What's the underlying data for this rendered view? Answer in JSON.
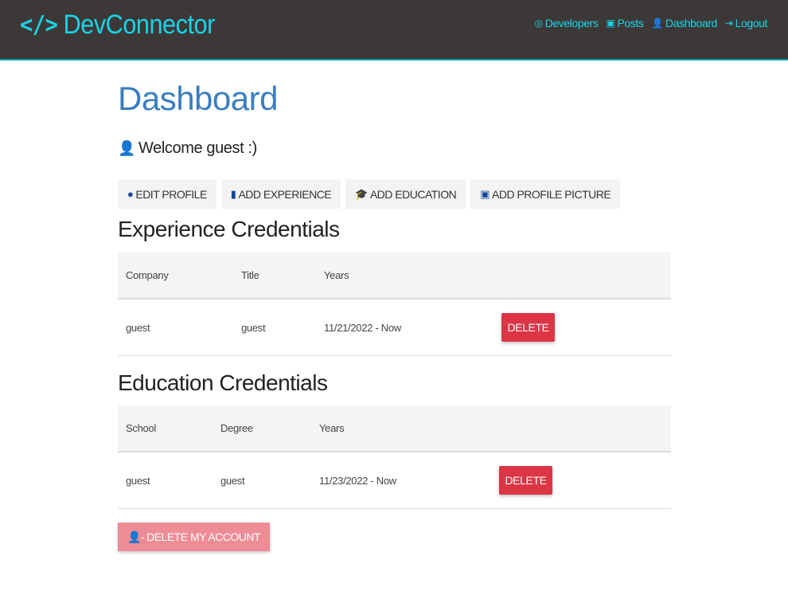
{
  "navbar": {
    "brand_icon": "</>",
    "brand": "DevConnector",
    "links": [
      {
        "label": "Developers",
        "icon": "◎"
      },
      {
        "label": "Posts",
        "icon": "▣"
      },
      {
        "label": "Dashboard",
        "icon": "👤"
      },
      {
        "label": "Logout",
        "icon": "⇥"
      }
    ]
  },
  "page": {
    "title": "Dashboard",
    "welcome_icon": "👤",
    "welcome": "Welcome guest :)"
  },
  "actions": [
    {
      "label": "EDIT PROFILE",
      "icon": "●"
    },
    {
      "label": "ADD EXPERIENCE",
      "icon": "▮"
    },
    {
      "label": "ADD EDUCATION",
      "icon": "🎓"
    },
    {
      "label": "ADD PROFILE PICTURE",
      "icon": "▣"
    }
  ],
  "experience": {
    "heading": "Experience Credentials",
    "headers": [
      "Company",
      "Title",
      "Years"
    ],
    "rows": [
      {
        "company": "guest",
        "title": "guest",
        "years": "11/21/2022 - Now",
        "delete": "DELETE"
      }
    ]
  },
  "education": {
    "heading": "Education Credentials",
    "headers": [
      "School",
      "Degree",
      "Years"
    ],
    "rows": [
      {
        "school": "guest",
        "degree": "guest",
        "years": "11/23/2022 - Now",
        "delete": "DELETE"
      }
    ]
  },
  "delete_account": {
    "icon": "👤-",
    "label": "DELETE MY ACCOUNT"
  },
  "colors": {
    "navbar_bg": "#3d3838",
    "brand": "#17d4e6",
    "title": "#3a7ebf",
    "danger": "#dc3545",
    "danger_light": "#ee8c96"
  }
}
